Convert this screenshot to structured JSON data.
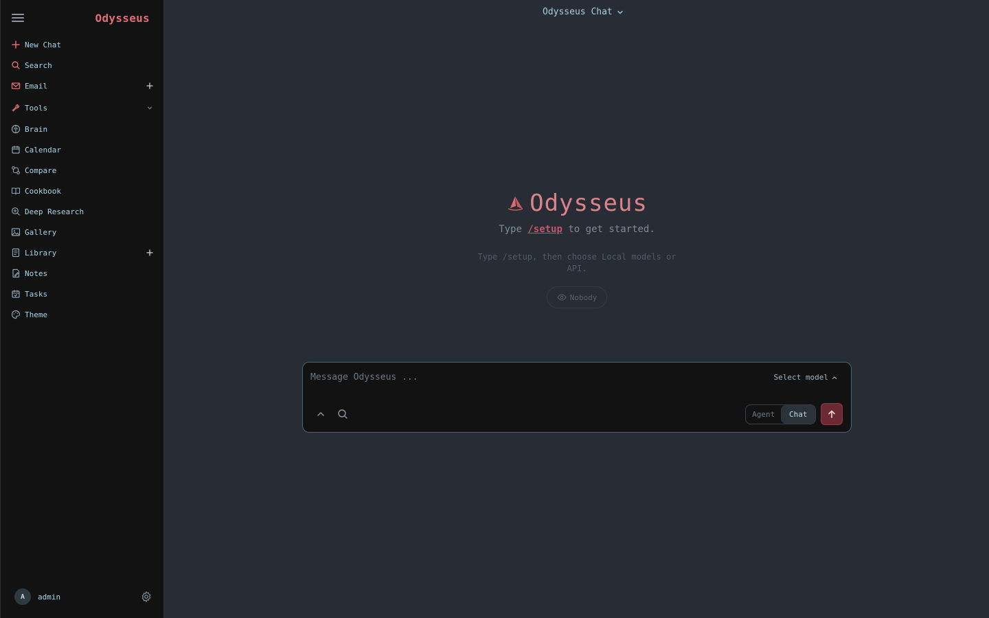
{
  "app": {
    "brand": "Odysseus",
    "top_title": "Odysseus Chat"
  },
  "sidebar": {
    "items": [
      {
        "label": "New Chat",
        "icon": "plus-icon"
      },
      {
        "label": "Search",
        "icon": "search-icon"
      },
      {
        "label": "Email",
        "icon": "mail-icon",
        "trailing": "plus-icon"
      },
      {
        "label": "Tools",
        "icon": "wrench-icon",
        "trailing": "chevron-down-icon"
      },
      {
        "label": "Brain",
        "icon": "brain-icon"
      },
      {
        "label": "Calendar",
        "icon": "calendar-icon"
      },
      {
        "label": "Compare",
        "icon": "compare-icon"
      },
      {
        "label": "Cookbook",
        "icon": "book-icon"
      },
      {
        "label": "Deep Research",
        "icon": "research-icon"
      },
      {
        "label": "Gallery",
        "icon": "image-icon"
      },
      {
        "label": "Library",
        "icon": "library-icon",
        "trailing": "plus-icon"
      },
      {
        "label": "Notes",
        "icon": "notes-icon"
      },
      {
        "label": "Tasks",
        "icon": "tasks-icon"
      },
      {
        "label": "Theme",
        "icon": "palette-icon"
      }
    ],
    "user": {
      "initial": "A",
      "name": "admin"
    }
  },
  "hero": {
    "title": "Odysseus",
    "sub_prefix": "Type",
    "sub_command": "/setup",
    "sub_suffix": "to get started.",
    "hint": "Type /setup, then choose Local models or API.",
    "visibility": "Nobody"
  },
  "composer": {
    "placeholder": "Message Odysseus ...",
    "model_label": "Select model",
    "mode_agent": "Agent",
    "mode_chat": "Chat",
    "active_mode": "Chat"
  },
  "colors": {
    "accent": "#e06c75",
    "sidebar_text": "#a9d3e6",
    "background": "#282c34",
    "sidebar_bg": "#121212"
  }
}
